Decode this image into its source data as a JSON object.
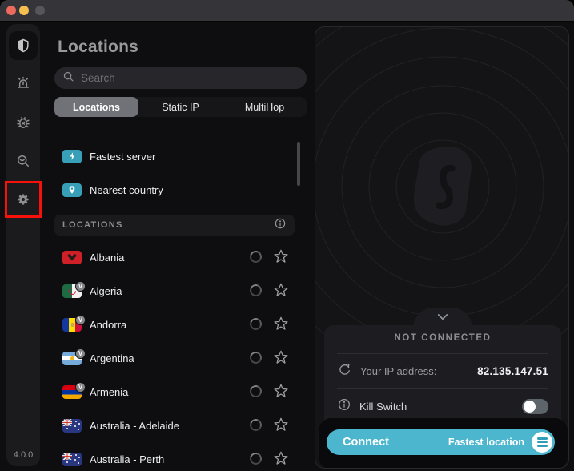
{
  "titlebar": {
    "buttons": [
      "close",
      "minimize",
      "zoom-disabled"
    ]
  },
  "sidebar": {
    "items": [
      {
        "id": "vpn",
        "icon": "shield-icon",
        "active": true
      },
      {
        "id": "alert",
        "icon": "siren-icon",
        "active": false
      },
      {
        "id": "antivirus",
        "icon": "bug-icon",
        "active": false
      },
      {
        "id": "search",
        "icon": "search-eye-icon",
        "active": false
      },
      {
        "id": "settings",
        "icon": "gear-icon",
        "active": false,
        "annotated": true
      }
    ],
    "version": "4.0.0"
  },
  "locations": {
    "title": "Locations",
    "search_placeholder": "Search",
    "tabs": [
      {
        "label": "Locations",
        "active": true
      },
      {
        "label": "Static IP",
        "active": false
      },
      {
        "label": "MultiHop",
        "active": false
      }
    ],
    "quick": [
      {
        "label": "Fastest server",
        "icon": "lightning-icon"
      },
      {
        "label": "Nearest country",
        "icon": "location-pin-icon"
      }
    ],
    "section": {
      "label": "LOCATIONS",
      "icon": "info-icon"
    },
    "virtual_badge": "V",
    "countries": [
      {
        "name": "Albania",
        "flag": "albania",
        "virtual": false
      },
      {
        "name": "Algeria",
        "flag": "algeria",
        "virtual": true
      },
      {
        "name": "Andorra",
        "flag": "andorra",
        "virtual": true
      },
      {
        "name": "Argentina",
        "flag": "argentina",
        "virtual": true
      },
      {
        "name": "Armenia",
        "flag": "armenia",
        "virtual": true
      },
      {
        "name": "Australia - Adelaide",
        "flag": "australia",
        "virtual": false
      },
      {
        "name": "Australia - Perth",
        "flag": "australia",
        "virtual": false
      }
    ]
  },
  "connection": {
    "status": "NOT CONNECTED",
    "ip_label": "Your IP address:",
    "ip_value": "82.135.147.51",
    "kill_switch_label": "Kill Switch",
    "kill_switch_on": false,
    "connect_label": "Connect",
    "connect_sublabel": "Fastest location"
  },
  "colors": {
    "accent_teal": "#4cb6ce",
    "annotation_red": "#f6120a",
    "traffic_red": "#ec6a5e",
    "traffic_yellow": "#f4bf4f",
    "traffic_gray": "#56565b"
  }
}
